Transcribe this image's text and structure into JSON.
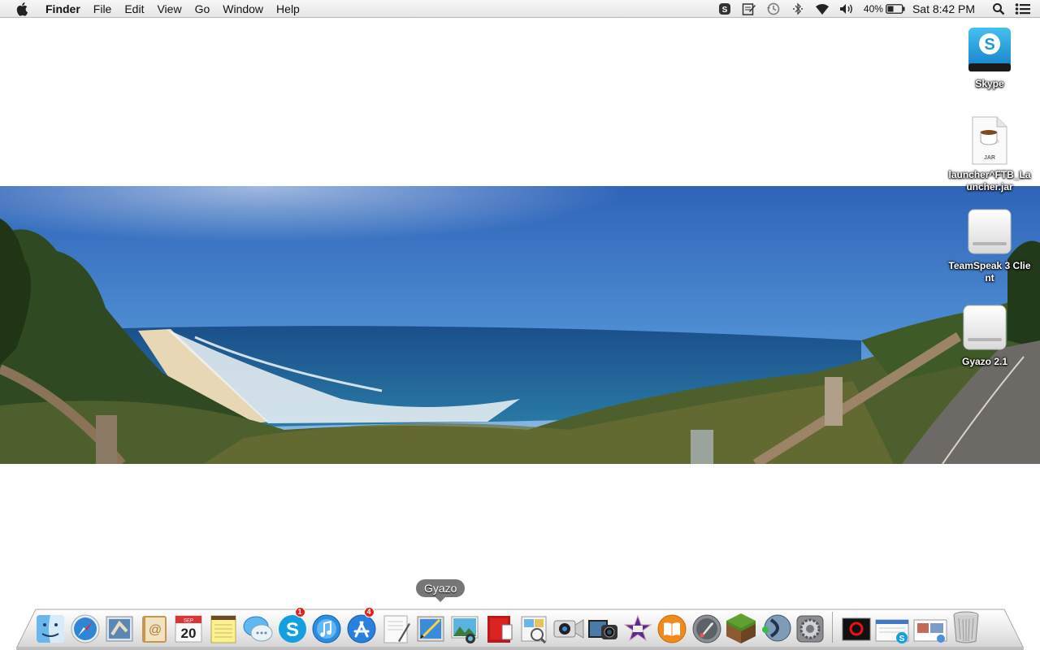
{
  "menubar": {
    "app_name": "Finder",
    "menus": [
      "File",
      "Edit",
      "View",
      "Go",
      "Window",
      "Help"
    ],
    "battery_percent": "40%",
    "clock": "Sat 8:42 PM",
    "status_icons": [
      "skype-status-icon",
      "notes-icon",
      "time-machine-icon",
      "bluetooth-icon",
      "wifi-icon",
      "volume-icon",
      "battery-icon",
      "spotlight-icon",
      "notification-center-icon"
    ]
  },
  "desktop": {
    "icons": [
      {
        "name": "Skype",
        "kind": "skype-disk"
      },
      {
        "name": "launcher^FTB_Launcher.jar",
        "kind": "jar-file"
      },
      {
        "name": "TeamSpeak 3 Client",
        "kind": "external-disk"
      },
      {
        "name": "Gyazo 2.1",
        "kind": "external-disk"
      }
    ]
  },
  "dock": {
    "tooltip": "Gyazo",
    "apps": [
      {
        "name": "Finder",
        "icon": "finder-icon"
      },
      {
        "name": "Safari",
        "icon": "safari-icon"
      },
      {
        "name": "Mail",
        "icon": "mail-icon"
      },
      {
        "name": "Contacts",
        "icon": "contacts-icon"
      },
      {
        "name": "Calendar",
        "icon": "calendar-icon",
        "date_month": "SEP",
        "date_day": "20"
      },
      {
        "name": "Notes",
        "icon": "notes-icon"
      },
      {
        "name": "Messages",
        "icon": "messages-icon"
      },
      {
        "name": "Skype",
        "icon": "skype-icon",
        "badge": "1"
      },
      {
        "name": "iTunes",
        "icon": "itunes-icon"
      },
      {
        "name": "App Store",
        "icon": "app-store-icon",
        "badge": "4"
      },
      {
        "name": "TextEdit",
        "icon": "textedit-icon"
      },
      {
        "name": "Gyazo",
        "icon": "gyazo-icon"
      },
      {
        "name": "iPhoto",
        "icon": "iphoto-icon"
      },
      {
        "name": "Photo Booth",
        "icon": "photo-booth-icon"
      },
      {
        "name": "Preview",
        "icon": "preview-icon"
      },
      {
        "name": "FaceTime",
        "icon": "facetime-icon"
      },
      {
        "name": "Image Capture",
        "icon": "image-capture-icon"
      },
      {
        "name": "iMovie",
        "icon": "imovie-icon"
      },
      {
        "name": "iBooks",
        "icon": "ibooks-icon"
      },
      {
        "name": "Launchpad",
        "icon": "launchpad-icon"
      },
      {
        "name": "Minecraft",
        "icon": "minecraft-icon"
      },
      {
        "name": "TeamSpeak 3",
        "icon": "teamspeak-icon"
      },
      {
        "name": "System Preferences",
        "icon": "system-preferences-icon"
      }
    ],
    "stacks": [
      {
        "name": "Console",
        "icon": "console-icon"
      },
      {
        "name": "Downloads",
        "icon": "downloads-stack-icon"
      },
      {
        "name": "Documents",
        "icon": "documents-stack-icon"
      },
      {
        "name": "Trash",
        "icon": "trash-icon"
      }
    ],
    "colors": {
      "accent": "#1a9bd7",
      "badge": "#e0221b"
    }
  }
}
